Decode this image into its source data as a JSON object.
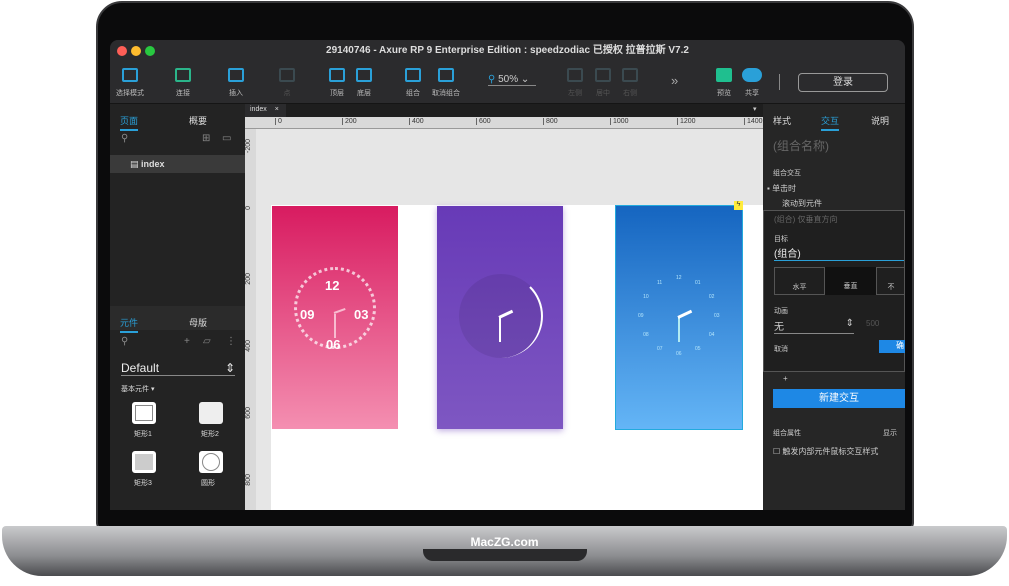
{
  "window": {
    "title": "29140746 - Axure RP 9 Enterprise Edition : speedzodiac 已授权    拉普拉斯 V7.2"
  },
  "toolbar": {
    "select_mode": "选择模式",
    "connect": "连接",
    "insert": "插入",
    "point": "点",
    "top": "顶层",
    "bottom": "底层",
    "group": "组合",
    "ungroup": "取消组合",
    "zoom": "50%",
    "align_left": "左侧",
    "align_center": "居中",
    "align_right": "右侧",
    "more": "»",
    "preview": "预览",
    "share": "共享",
    "login": "登录"
  },
  "left_panel": {
    "tabs": [
      "页面",
      "概要"
    ],
    "pages": [
      "index"
    ],
    "lib_tabs": [
      "元件",
      "母版"
    ],
    "library": "Default",
    "category": "基本元件 ▾",
    "widgets": [
      "矩形1",
      "矩形2",
      "矩形3",
      "圆形"
    ]
  },
  "canvas": {
    "tab": "index",
    "ruler_x": [
      "0",
      "200",
      "400",
      "600",
      "800",
      "1000",
      "1200",
      "1400"
    ],
    "ruler_y": [
      "-200",
      "0",
      "200",
      "400",
      "600",
      "800"
    ],
    "clock1": {
      "n12": "12",
      "n3": "03",
      "n6": "06",
      "n9": "09"
    },
    "clock3": [
      "12",
      "01",
      "02",
      "03",
      "04",
      "05",
      "06",
      "07",
      "08",
      "09",
      "10",
      "11"
    ]
  },
  "right_panel": {
    "tabs": [
      "样式",
      "交互",
      "说明"
    ],
    "name_placeholder": "(组合名称)",
    "section": "组合交互",
    "event": "单击时",
    "action": "滚动到元件",
    "action_desc": "(组合) 仅垂直方向",
    "target_label": "目标",
    "target": "(组合)",
    "directions": [
      "水平",
      "垂直",
      "不"
    ],
    "anim_label": "动画",
    "anim": "无",
    "duration": "500",
    "cancel": "取消",
    "ok": "确",
    "plus": "+",
    "new_interaction": "新建交互",
    "props": "组合属性",
    "show": "显示",
    "checkbox": "触发内部元件鼠标交互样式"
  },
  "brand": "MacZG.com",
  "colors": {
    "accent": "#2aa0d8",
    "pink": "#d81b60",
    "purple": "#673ab7",
    "blue": "#1565c0"
  }
}
